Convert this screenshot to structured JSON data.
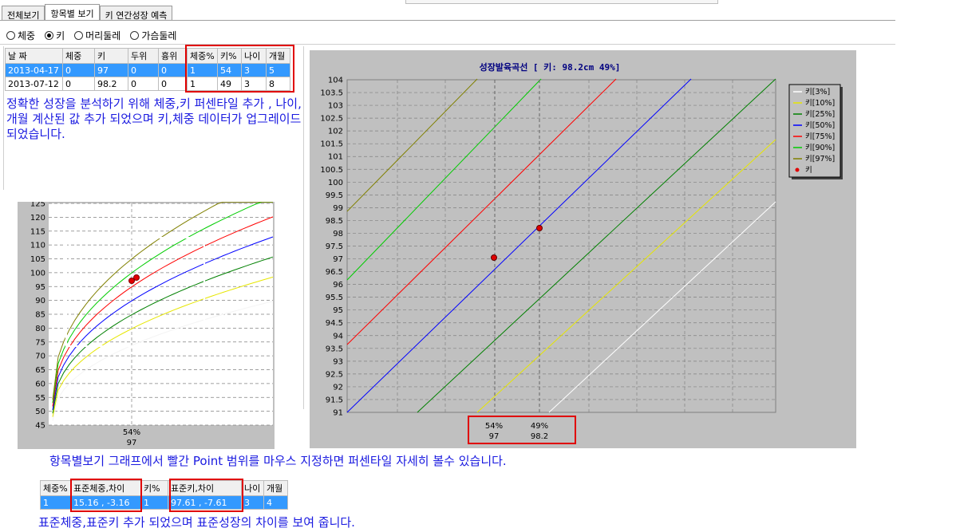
{
  "tabs": [
    {
      "label": "전체보기",
      "active": false
    },
    {
      "label": "항목별 보기",
      "active": true
    },
    {
      "label": "키 연간성장 예측",
      "active": false
    }
  ],
  "radios": [
    {
      "label": "체중",
      "checked": false
    },
    {
      "label": "키",
      "checked": true
    },
    {
      "label": "머리둘레",
      "checked": false
    },
    {
      "label": "가슴둘레",
      "checked": false
    }
  ],
  "table1": {
    "headers": [
      "날 짜",
      "체중",
      "키",
      "두위",
      "흉위",
      "체중%",
      "키%",
      "나이",
      "개월"
    ],
    "rows": [
      [
        "2013-04-17",
        "0",
        "97",
        "0",
        "0",
        "1",
        "54",
        "3",
        "5"
      ],
      [
        "2013-07-12",
        "0",
        "98.2",
        "0",
        "0",
        "1",
        "49",
        "3",
        "8"
      ]
    ]
  },
  "notes": {
    "note1": "정확한 성장을 분석하기 위해 체중,키 퍼센타일 추가 , 나이,개월 계산된 값 추가 되었으며 키,체중 데이터가 업그레이드 되었습니다.",
    "note2": "항목별보기 그래프에서 빨간 Point 범위를 마우스 지정하면 퍼센타일 자세히 볼수 있습니다.",
    "note3": "표준체중,표준키 추가 되었으며 표준성장의 차이를 보여 줍니다."
  },
  "table2": {
    "headers": [
      "체중%",
      "표준체중,차이",
      "키%",
      "표준키,차이",
      "나이",
      "개월"
    ],
    "rows": [
      [
        "1",
        "15.16 , -3.16",
        "1",
        "97.61 , -7.61",
        "3",
        "4"
      ]
    ]
  },
  "colors": {
    "p3": "#ffffff",
    "p10": "#e6e600",
    "p25": "#008000",
    "p50": "#0000ff",
    "p75": "#ff0000",
    "p90": "#00cc00",
    "p97": "#808000",
    "point": "#e00000",
    "plot_bg": "#c0c0c0",
    "grid": "#808080"
  },
  "chart_data": [
    {
      "type": "line",
      "title": "성장발육곡선 [ 키: 98.2cm  49%]",
      "ylim": [
        91,
        104
      ],
      "y_ticks": [
        "91",
        "91.5",
        "92",
        "92.5",
        "93",
        "93.5",
        "94",
        "94.5",
        "95",
        "95.5",
        "96",
        "96.5",
        "97",
        "97.5",
        "98",
        "98.5",
        "99",
        "99.5",
        "100",
        "100.5",
        "101",
        "101.5",
        "102",
        "102.5",
        "103",
        "103.5",
        "104"
      ],
      "legend": [
        "키[3%]",
        "키[10%]",
        "키[25%]",
        "키[50%]",
        "키[75%]",
        "키[90%]",
        "키[97%]",
        "키"
      ],
      "legend_position": "top-right",
      "x_labels": [
        {
          "percent": "54%",
          "value": "97"
        },
        {
          "percent": "49%",
          "value": "98.2"
        }
      ],
      "points": [
        97,
        98.2
      ]
    },
    {
      "type": "line",
      "ylim": [
        45,
        125
      ],
      "y_ticks": [
        "45",
        "50",
        "55",
        "60",
        "65",
        "70",
        "75",
        "80",
        "85",
        "90",
        "95",
        "100",
        "105",
        "110",
        "115",
        "120",
        "125"
      ],
      "x_labels": [
        {
          "percent": "54%",
          "value": "97"
        }
      ],
      "points": [
        97,
        98.2
      ]
    }
  ]
}
